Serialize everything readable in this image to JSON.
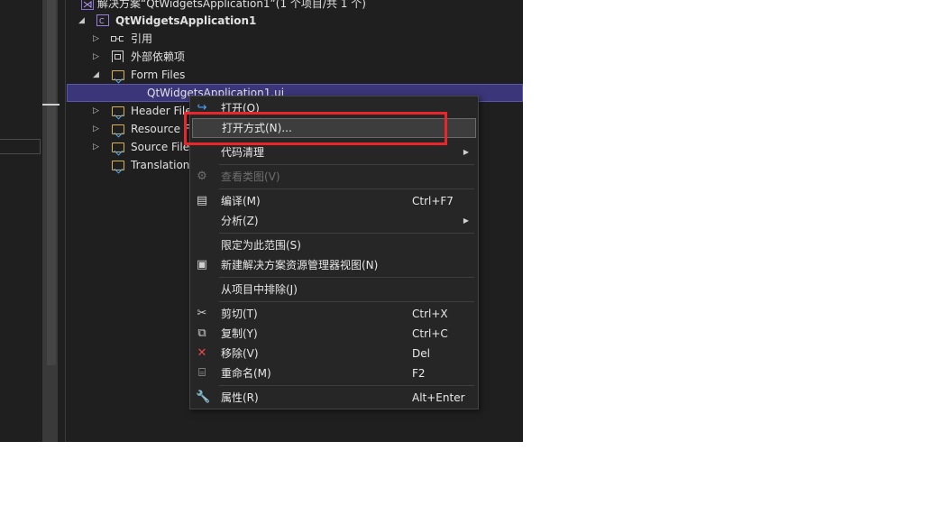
{
  "solution": {
    "title": "解决方案“QtWidgetsApplication1”(1 个项目/共 1 个)"
  },
  "tree": {
    "project": "QtWidgetsApplication1",
    "items": [
      {
        "label": "引用"
      },
      {
        "label": "外部依赖项"
      },
      {
        "label": "Form Files"
      },
      {
        "label": "QtWidgetsApplication1.ui"
      },
      {
        "label": "Header Files"
      },
      {
        "label": "Resource Files"
      },
      {
        "label": "Source Files"
      },
      {
        "label": "Translation Files"
      }
    ]
  },
  "context_menu": {
    "items": [
      {
        "label": "打开(O)",
        "shortcut": "",
        "icon": "open-icon"
      },
      {
        "label": "打开方式(N)...",
        "shortcut": "",
        "icon": ""
      },
      {
        "label": "代码清理",
        "shortcut": "",
        "icon": "",
        "submenu": true
      },
      {
        "label": "查看类图(V)",
        "shortcut": "",
        "icon": "class-diagram-icon",
        "disabled": true
      },
      {
        "label": "编译(M)",
        "shortcut": "Ctrl+F7",
        "icon": "compile-icon"
      },
      {
        "label": "分析(Z)",
        "shortcut": "",
        "icon": "",
        "submenu": true
      },
      {
        "label": "限定为此范围(S)",
        "shortcut": "",
        "icon": ""
      },
      {
        "label": "新建解决方案资源管理器视图(N)",
        "shortcut": "",
        "icon": "new-view-icon"
      },
      {
        "label": "从项目中排除(J)",
        "shortcut": "",
        "icon": ""
      },
      {
        "label": "剪切(T)",
        "shortcut": "Ctrl+X",
        "icon": "cut-icon"
      },
      {
        "label": "复制(Y)",
        "shortcut": "Ctrl+C",
        "icon": "copy-icon"
      },
      {
        "label": "移除(V)",
        "shortcut": "Del",
        "icon": "remove-icon"
      },
      {
        "label": "重命名(M)",
        "shortcut": "F2",
        "icon": "rename-icon"
      },
      {
        "label": "属性(R)",
        "shortcut": "Alt+Enter",
        "icon": "wrench-icon"
      }
    ]
  },
  "colors": {
    "background": "#1f1f1f",
    "selection": "#3b3679",
    "highlight_box": "#e8262b",
    "menu_bg": "#262626"
  }
}
